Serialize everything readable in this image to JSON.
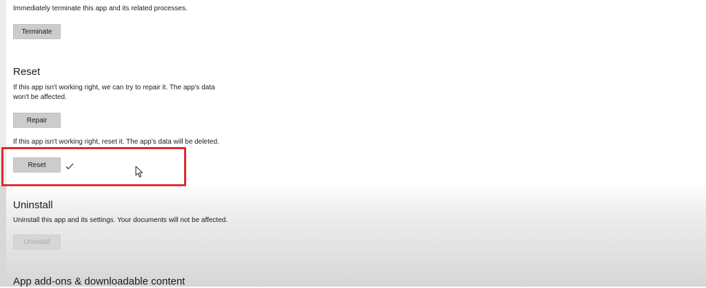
{
  "end_task": {
    "description": "Immediately terminate this app and its related processes.",
    "terminate_label": "Terminate"
  },
  "reset_section": {
    "title": "Reset",
    "repair_description_line1": "If this app isn't working right, we can try to repair it. The app's data",
    "repair_description_line2": "won't be affected.",
    "repair_label": "Repair",
    "reset_description": "If this app isn't working right, reset it. The app's data will be deleted.",
    "reset_label": "Reset",
    "reset_status_icon": "checkmark-icon",
    "highlight_color": "#e3262d"
  },
  "uninstall_section": {
    "title": "Uninstall",
    "description": "Uninstall this app and its settings. Your documents will not be affected.",
    "uninstall_label": "Uninstall"
  },
  "addons_section": {
    "title": "App add-ons & downloadable content"
  },
  "cursor": {
    "icon": "mouse-pointer-icon"
  }
}
